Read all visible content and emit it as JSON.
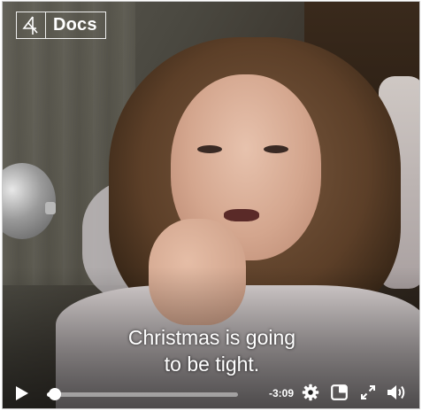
{
  "logo": {
    "mark": "4",
    "label": "Docs"
  },
  "subtitle": {
    "line1": "Christmas is going",
    "line2": "to be tight."
  },
  "controls": {
    "time_remaining": "-3:09",
    "progress_fraction": 0.03,
    "icons": [
      "play-icon",
      "gear-icon",
      "picture-in-picture-icon",
      "expand-icon",
      "volume-icon"
    ]
  },
  "colors": {
    "control": "#ffffff",
    "track": "#9a9590"
  }
}
